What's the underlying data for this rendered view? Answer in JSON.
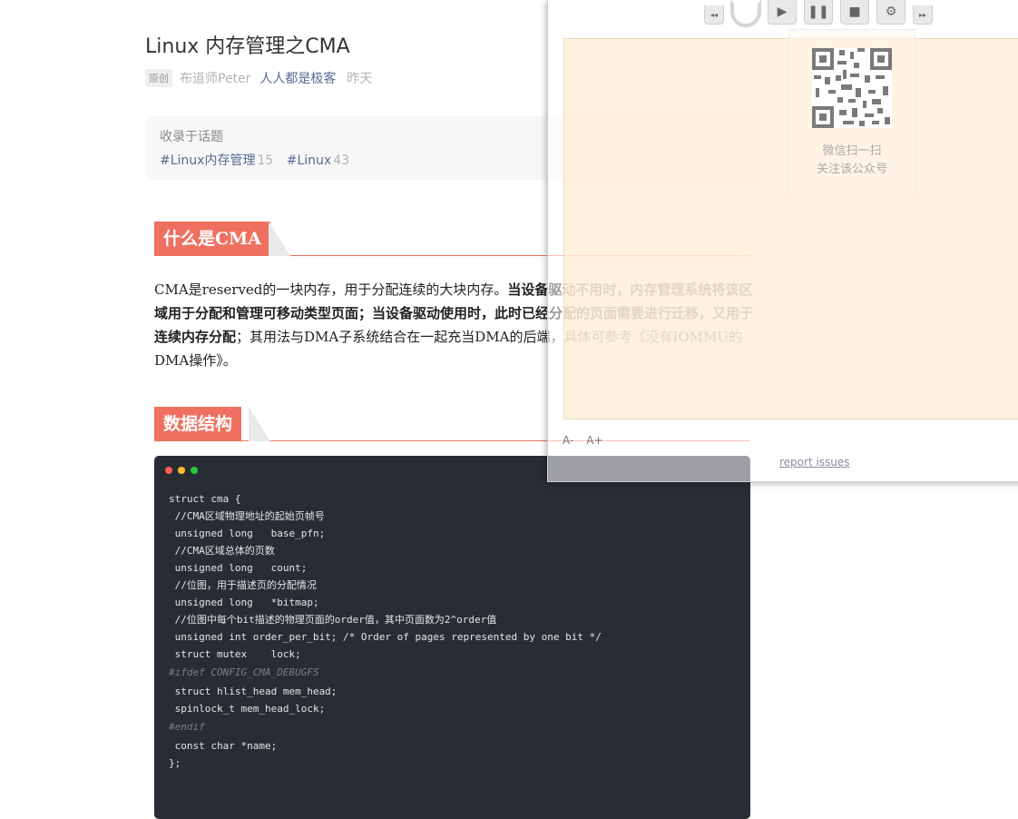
{
  "article": {
    "title": "Linux 内存管理之CMA",
    "badge": "原创",
    "author": "布道师Peter",
    "account": "人人都是极客",
    "date": "昨天"
  },
  "topics": {
    "label": "收录于话题",
    "tags": [
      {
        "name": "#Linux内存管理",
        "count": "15"
      },
      {
        "name": "#Linux",
        "count": "43"
      }
    ]
  },
  "sections": {
    "h1": "什么是CMA",
    "h2": "数据结构"
  },
  "paragraph": {
    "p1": "CMA是reserved的一块内存，用于分配连续的大块内存。",
    "p2": "当设备驱动不用时，内存管理系统将该区域用于分配和管理可移动类型页面；当设备驱动使用时，此时已经分配的页面需要进行迁移，又用于连续内存分配",
    "p3": "；其用法与DMA子系统结合在一起充当DMA的后端，具体可参考《没有IOMMU的DMA操作》。"
  },
  "code": {
    "dot_colors": [
      "#ff5f56",
      "#ffbd2e",
      "#27c93f"
    ],
    "lines": [
      {
        "text": "struct cma {",
        "kind": "code"
      },
      {
        "text": " //CMA区域物理地址的起始页帧号",
        "kind": "code"
      },
      {
        "text": " unsigned long   base_pfn;",
        "kind": "code"
      },
      {
        "text": " //CMA区域总体的页数",
        "kind": "code"
      },
      {
        "text": " unsigned long   count;",
        "kind": "code"
      },
      {
        "text": " //位图，用于描述页的分配情况",
        "kind": "code"
      },
      {
        "text": " unsigned long   *bitmap;",
        "kind": "code"
      },
      {
        "text": " //位图中每个bit描述的物理页面的order值，其中页面数为2^order值",
        "kind": "code"
      },
      {
        "text": " unsigned int order_per_bit; /* Order of pages represented by one bit */",
        "kind": "code"
      },
      {
        "text": " struct mutex    lock;",
        "kind": "code"
      },
      {
        "text": "#ifdef CONFIG_CMA_DEBUGFS",
        "kind": "pp"
      },
      {
        "text": " struct hlist_head mem_head;",
        "kind": "code"
      },
      {
        "text": " spinlock_t mem_head_lock;",
        "kind": "code"
      },
      {
        "text": "#endif",
        "kind": "pp"
      },
      {
        "text": " const char *name;",
        "kind": "code"
      },
      {
        "text": "};",
        "kind": "code"
      }
    ]
  },
  "overlay": {
    "controls": [
      {
        "name": "rewind-icon",
        "glyph": "◂◂"
      },
      {
        "name": "play-icon",
        "glyph": "▶"
      },
      {
        "name": "pause-icon",
        "glyph": "❚❚"
      },
      {
        "name": "stop-icon",
        "glyph": "■"
      },
      {
        "name": "gear-icon",
        "glyph": "⚙"
      },
      {
        "name": "fast-forward-icon",
        "glyph": "▸▸"
      }
    ],
    "qr_caption_1": "微信扫一扫",
    "qr_caption_2": "关注该公众号",
    "font_decrease": "A-",
    "font_increase": "A+",
    "dash": "-",
    "report": "report issues"
  }
}
